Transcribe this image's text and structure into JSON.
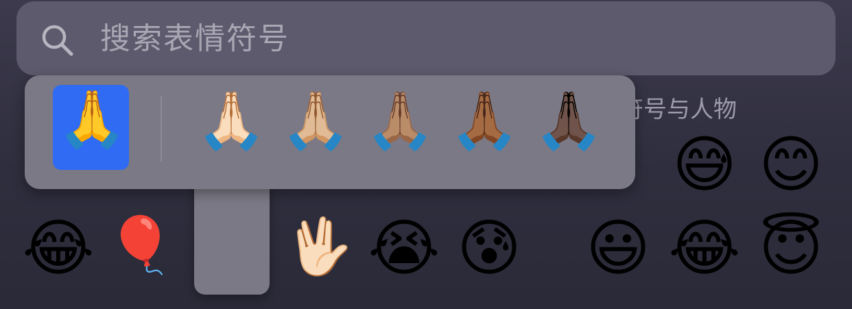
{
  "search": {
    "placeholder": "搜索表情符号",
    "icon": "magnifying-glass-icon"
  },
  "section": {
    "title": "情符号与人物"
  },
  "skin_tone_picker": {
    "selected": {
      "glyph": "🙏",
      "tone": "default-yellow"
    },
    "options": [
      {
        "glyph": "🙏🏻",
        "tone": "light"
      },
      {
        "glyph": "🙏🏼",
        "tone": "medium-light"
      },
      {
        "glyph": "🙏🏽",
        "tone": "medium"
      },
      {
        "glyph": "🙏🏾",
        "tone": "medium-dark"
      },
      {
        "glyph": "🙏🏿",
        "tone": "dark"
      }
    ],
    "colors": {
      "panel": "#7b7985",
      "selected_bg": "#2f6bf3"
    }
  },
  "grid": {
    "row2": [
      {
        "glyph": "😅",
        "name": "grinning-face-with-sweat"
      },
      {
        "glyph": "😊",
        "name": "smiling-face-with-smiling-eyes"
      }
    ],
    "row3": [
      {
        "glyph": "😂",
        "name": "face-with-tears-of-joy"
      },
      {
        "glyph": "🎈",
        "name": "balloon"
      },
      {
        "glyph": "🖖🏻",
        "name": "vulcan-salute"
      },
      {
        "glyph": "😭",
        "name": "loudly-crying-face"
      },
      {
        "glyph": "😰",
        "name": "anxious-face-with-sweat"
      },
      {
        "glyph": "😃",
        "name": "grinning-face-with-big-eyes"
      },
      {
        "glyph": "😂",
        "name": "face-with-tears-of-joy-2"
      },
      {
        "glyph": "😇",
        "name": "smiling-face-with-halo"
      }
    ]
  }
}
